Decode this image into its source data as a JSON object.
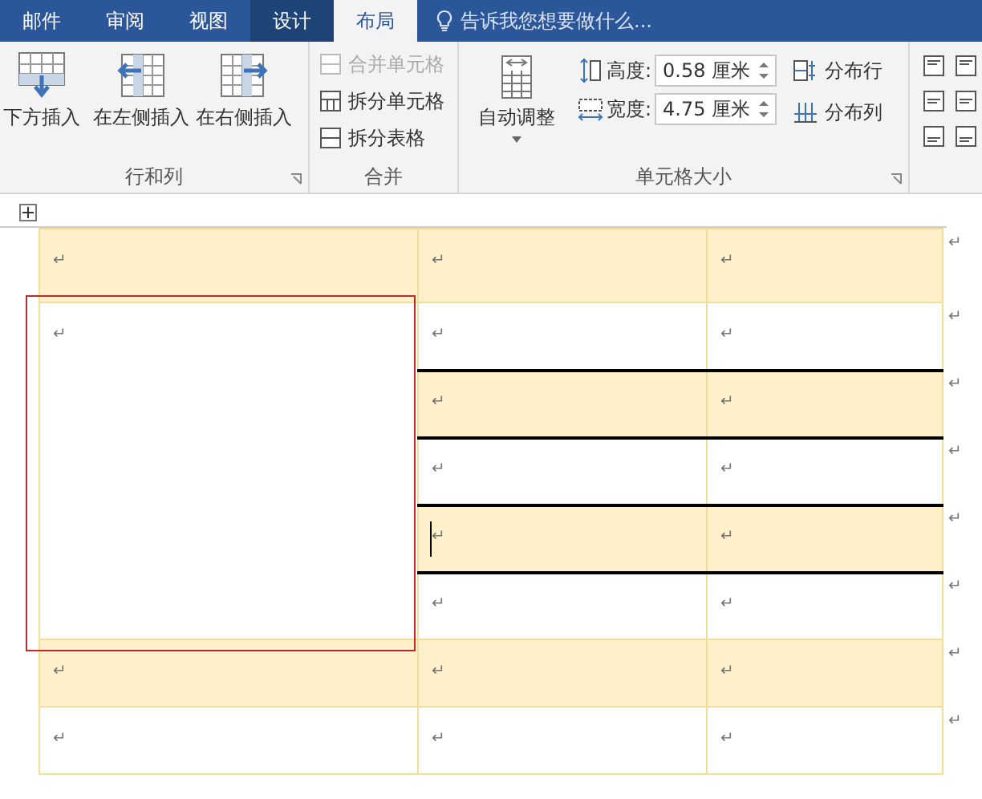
{
  "tabs": [
    {
      "label": "邮件",
      "selected": false,
      "contextual": false
    },
    {
      "label": "审阅",
      "selected": false,
      "contextual": false
    },
    {
      "label": "视图",
      "selected": false,
      "contextual": false
    },
    {
      "label": "设计",
      "selected": false,
      "contextual": true
    },
    {
      "label": "布局",
      "selected": true,
      "contextual": true
    }
  ],
  "search": {
    "placeholder": "告诉我您想要做什么..."
  },
  "ribbon": {
    "rows_columns": {
      "label": "行和列",
      "buttons": [
        "下方插入",
        "在左侧插入",
        "在右侧插入"
      ]
    },
    "merge": {
      "label": "合并",
      "items": [
        {
          "label": "合并单元格",
          "disabled": true
        },
        {
          "label": "拆分单元格",
          "disabled": false
        },
        {
          "label": "拆分表格",
          "disabled": false
        }
      ]
    },
    "cell_size": {
      "label": "单元格大小",
      "autofit": "自动调整",
      "height_label": "高度:",
      "height": "0.58 厘米",
      "width_label": "宽度:",
      "width": "4.75 厘米",
      "distribute_rows": "分布行",
      "distribute_columns": "分布列"
    }
  },
  "table": {
    "rows": [
      {
        "shaded": true,
        "ruled": false,
        "end_mark": "↵",
        "cells": [
          {
            "text": "↵",
            "outlined": false,
            "cursor": false
          },
          {
            "text": "↵",
            "outlined": false,
            "cursor": false
          },
          {
            "text": "↵",
            "outlined": false,
            "cursor": false
          }
        ]
      },
      {
        "shaded": false,
        "ruled": false,
        "end_mark": "↵",
        "cells": [
          {
            "text": "↵",
            "rowspan": 5,
            "outlined": true,
            "cursor": false
          },
          {
            "text": "↵",
            "outlined": false,
            "cursor": false
          },
          {
            "text": "↵",
            "outlined": false,
            "cursor": false
          }
        ]
      },
      {
        "shaded": true,
        "ruled": true,
        "end_mark": "↵",
        "cells": [
          {
            "text": "↵",
            "outlined": false,
            "cursor": false
          },
          {
            "text": "↵",
            "outlined": false,
            "cursor": false
          }
        ]
      },
      {
        "shaded": false,
        "ruled": true,
        "end_mark": "↵",
        "cells": [
          {
            "text": "↵",
            "outlined": false,
            "cursor": false
          },
          {
            "text": "↵",
            "outlined": false,
            "cursor": false
          }
        ]
      },
      {
        "shaded": true,
        "ruled": true,
        "end_mark": "↵",
        "cells": [
          {
            "text": "↵",
            "outlined": false,
            "cursor": true
          },
          {
            "text": "↵",
            "outlined": false,
            "cursor": false
          }
        ]
      },
      {
        "shaded": false,
        "ruled": true,
        "end_mark": "↵",
        "cells": [
          {
            "text": "↵",
            "outlined": false,
            "cursor": false
          },
          {
            "text": "↵",
            "outlined": false,
            "cursor": false
          }
        ]
      },
      {
        "shaded": true,
        "ruled": false,
        "end_mark": "↵",
        "cells": [
          {
            "text": "↵",
            "outlined": false,
            "cursor": false
          },
          {
            "text": "↵",
            "outlined": false,
            "cursor": false
          },
          {
            "text": "↵",
            "outlined": false,
            "cursor": false
          }
        ]
      },
      {
        "shaded": false,
        "ruled": false,
        "end_mark": "↵",
        "cells": [
          {
            "text": "↵",
            "outlined": false,
            "cursor": false
          },
          {
            "text": "↵",
            "outlined": false,
            "cursor": false
          },
          {
            "text": "↵",
            "outlined": false,
            "cursor": false
          }
        ]
      }
    ]
  }
}
